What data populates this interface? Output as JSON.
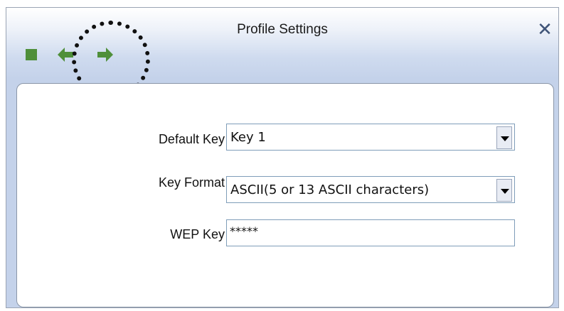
{
  "window": {
    "title": "Profile Settings",
    "close_glyph": "✕"
  },
  "toolbar": {
    "icons": [
      "stop-icon",
      "back-arrow-icon",
      "forward-arrow-icon"
    ],
    "icon_color": "#4f8f3a"
  },
  "form": {
    "default_key": {
      "label": "Default Key",
      "value": "Key 1"
    },
    "key_format": {
      "label": "Key Format",
      "value": "ASCII(5 or 13 ASCII characters)"
    },
    "wep_key": {
      "label": "WEP Key",
      "value": "*****"
    }
  }
}
